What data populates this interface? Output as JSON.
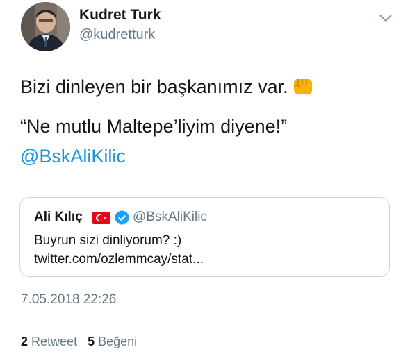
{
  "author": {
    "name": "Kudret Turk",
    "handle": "@kudretturk"
  },
  "tweet": {
    "line1": "Bizi dinleyen bir başkanımız var.",
    "line1_emoji": "fist-emoji",
    "line2": "“Ne mutlu Maltepe’liyim diyene!”",
    "mention": "@BskAliKilic"
  },
  "quote": {
    "name": "Ali Kılıç",
    "flag": "turkey-flag-icon",
    "verified": "verified-badge-icon",
    "handle": "@BskAliKilic",
    "text": "Buyrun sizi dinliyorum? :) twitter.com/ozlemmcay/stat..."
  },
  "timestamp": "7.05.2018 22:26",
  "stats": {
    "retweets_count": "2",
    "retweets_label": "Retweet",
    "likes_count": "5",
    "likes_label": "Beğeni"
  },
  "colors": {
    "link": "#1b95e0",
    "secondary_text": "#657786",
    "border": "#ccd6dd"
  }
}
